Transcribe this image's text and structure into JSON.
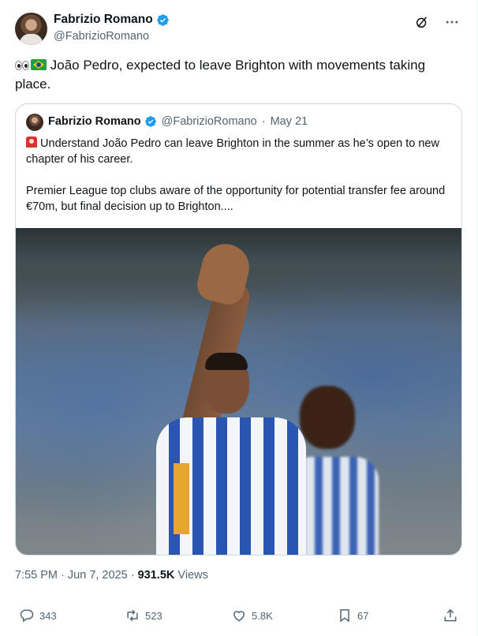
{
  "author": {
    "name": "Fabrizio Romano",
    "handle": "@FabrizioRomano"
  },
  "tweet": {
    "text": "João Pedro, expected to leave Brighton with movements taking place."
  },
  "quoted": {
    "name": "Fabrizio Romano",
    "handle": "@FabrizioRomano",
    "separator": "·",
    "date": "May 21",
    "para1": "Understand João Pedro can leave Brighton in the summer as he’s open to new chapter of his career.",
    "para2": "Premier League top clubs aware of the opportunity for potential transfer fee around €70m, but final decision up to Brighton...."
  },
  "meta": {
    "time": "7:55 PM",
    "sep1": "·",
    "date": "Jun 7, 2025",
    "sep2": "·",
    "views_count": "931.5K",
    "views_label": "Views"
  },
  "actions": {
    "replies": "343",
    "reposts": "523",
    "likes": "5.8K",
    "bookmarks": "67"
  },
  "colors": {
    "verified": "#1d9bf0",
    "secondary_text": "#536471",
    "border": "#cfd9de"
  },
  "icons": [
    "verified-icon",
    "grok-icon",
    "more-icon",
    "eyes-emoji",
    "brazil-flag-emoji",
    "siren-emoji",
    "reply-icon",
    "repost-icon",
    "like-icon",
    "bookmark-icon",
    "share-icon"
  ]
}
